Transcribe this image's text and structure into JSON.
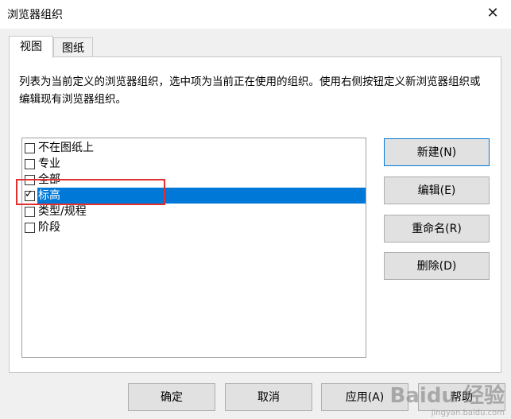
{
  "window": {
    "title": "浏览器组织",
    "close_glyph": "✕"
  },
  "tabs": [
    {
      "label": "视图",
      "active": true
    },
    {
      "label": "图纸",
      "active": false
    }
  ],
  "description": "列表为当前定义的浏览器组织，选中项为当前正在使用的组织。使用右侧按钮定义新浏览器组织或编辑现有浏览器组织。",
  "organizations": [
    {
      "label": "不在图纸上",
      "checked": false,
      "selected": false
    },
    {
      "label": "专业",
      "checked": false,
      "selected": false
    },
    {
      "label": "全部",
      "checked": false,
      "selected": false
    },
    {
      "label": "标高",
      "checked": true,
      "selected": true
    },
    {
      "label": "类型/规程",
      "checked": false,
      "selected": false
    },
    {
      "label": "阶段",
      "checked": false,
      "selected": false
    }
  ],
  "side_buttons": {
    "new": "新建(N)",
    "edit": "编辑(E)",
    "rename": "重命名(R)",
    "delete": "删除(D)"
  },
  "bottom_buttons": {
    "ok": "确定",
    "cancel": "取消",
    "apply": "应用(A)",
    "help": "帮助"
  },
  "watermark": {
    "text": "Baidu 经验",
    "sub": "jingyan.baidu.com"
  },
  "colors": {
    "selection": "#0078d7",
    "annotation_box": "#e0302f"
  }
}
